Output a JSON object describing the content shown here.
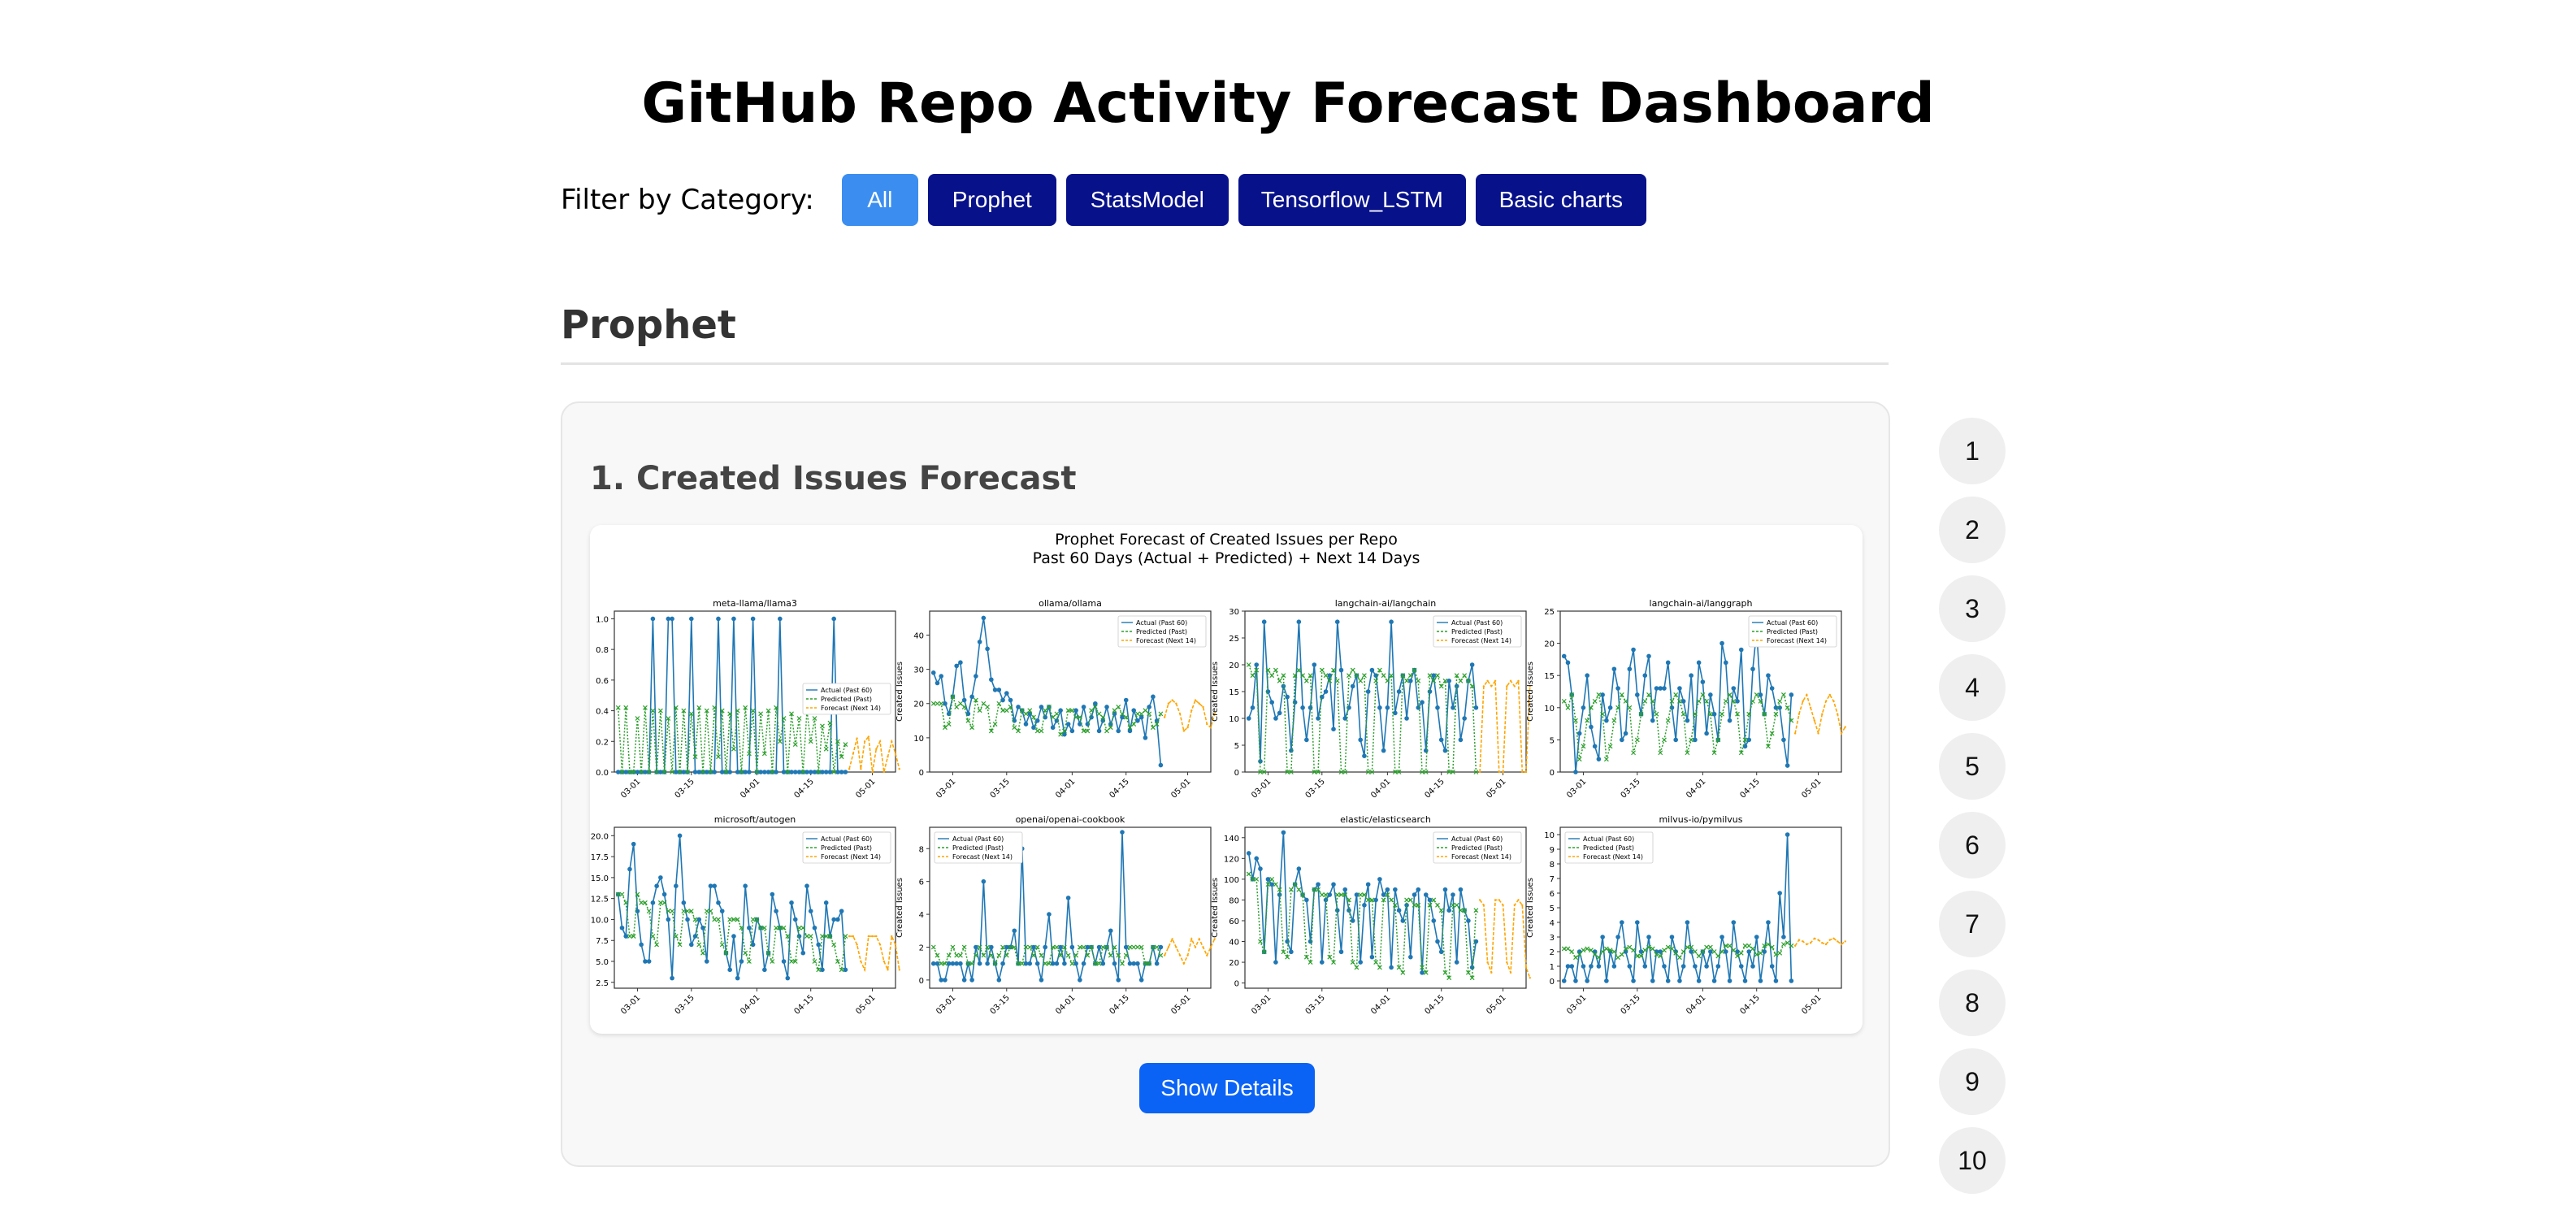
{
  "page": {
    "title": "GitHub Repo Activity Forecast Dashboard"
  },
  "filter": {
    "label": "Filter by Category:",
    "buttons": [
      "All",
      "Prophet",
      "StatsModel",
      "Tensorflow_LSTM",
      "Basic charts"
    ],
    "active": "All"
  },
  "section": {
    "title": "Prophet"
  },
  "card": {
    "title": "1. Created Issues Forecast",
    "button_label": "Show Details"
  },
  "nav": {
    "items": [
      "1",
      "2",
      "3",
      "4",
      "5",
      "6",
      "7",
      "8",
      "9",
      "10"
    ]
  },
  "colors": {
    "actual": "#1f77b4",
    "predicted": "#2ca02c",
    "forecast": "#ffa500",
    "button_dark": "#07118a",
    "button_active": "#3b8ef0",
    "button_primary": "#0b63f6"
  },
  "chart_data": {
    "type": "line",
    "title": "Prophet Forecast of Created Issues per Repo",
    "subtitle": "Past 60 Days (Actual + Predicted) + Next 14 Days",
    "ylabel": "Created Issues",
    "xticks": [
      "03-01",
      "03-15",
      "04-01",
      "04-15",
      "05-01"
    ],
    "x_range": [
      "2024-02-24",
      "2024-05-07"
    ],
    "actual_dates": [
      "2024-02-25",
      "2024-04-24"
    ],
    "forecast_dates": [
      "2024-04-25",
      "2024-05-08"
    ],
    "legend": [
      "Actual (Past 60)",
      "Predicted (Past)",
      "Forecast (Next 14)"
    ],
    "panels": [
      {
        "name": "meta-llama/llama3",
        "ylim": [
          0,
          1.05
        ],
        "yticks": [
          "0.0",
          "0.2",
          "0.4",
          "0.6",
          "0.8",
          "1.0"
        ],
        "legend_pos": "center-right",
        "actual": [
          0,
          0,
          0,
          0,
          0,
          0,
          0,
          0,
          0,
          1,
          0,
          0,
          0,
          1,
          1,
          0,
          0,
          0,
          0,
          1,
          0,
          0,
          0,
          0,
          0,
          0,
          1,
          0,
          0,
          0,
          1,
          0,
          0,
          0,
          0,
          1,
          0,
          0,
          0,
          0,
          0,
          0,
          1,
          0,
          0,
          0,
          0,
          0,
          0,
          0,
          0,
          0,
          0,
          0,
          0,
          0,
          1,
          0,
          0,
          0
        ],
        "predicted": [
          0.42,
          0,
          0.42,
          0,
          0,
          0.35,
          0,
          0.42,
          0,
          0.4,
          0,
          0.4,
          0,
          0.35,
          0,
          0.42,
          0,
          0.4,
          0,
          0.38,
          0.1,
          0.42,
          0,
          0.4,
          0,
          0.42,
          0.1,
          0.4,
          0,
          0.38,
          0.15,
          0.4,
          0,
          0.42,
          0.12,
          0.4,
          0,
          0.38,
          0.12,
          0.4,
          0,
          0.42,
          0.2,
          0.35,
          0,
          0.38,
          0.18,
          0.35,
          0,
          0.4,
          0.2,
          0.35,
          0,
          0.3,
          0.15,
          0.32,
          0,
          0.2,
          0.1,
          0.18
        ],
        "forecast": [
          0.02,
          0.12,
          0.22,
          0.02,
          0.2,
          0.23,
          0,
          0.15,
          0.2,
          0,
          0.1,
          0.2,
          0.12,
          0.02
        ]
      },
      {
        "name": "ollama/ollama",
        "ylim": [
          0,
          47
        ],
        "yticks": [
          "0",
          "10",
          "20",
          "30",
          "40"
        ],
        "legend_pos": "top-right",
        "actual": [
          29,
          26,
          28,
          20,
          17,
          22,
          31,
          32,
          21,
          17,
          22,
          28,
          38,
          45,
          36,
          27,
          24,
          24,
          21,
          23,
          21,
          15,
          19,
          18,
          14,
          17,
          13,
          15,
          19,
          16,
          19,
          13,
          15,
          18,
          11,
          14,
          12,
          18,
          14,
          19,
          14,
          16,
          20,
          12,
          15,
          19,
          14,
          17,
          12,
          16,
          21,
          12,
          18,
          15,
          16,
          10,
          19,
          22,
          15,
          2
        ],
        "predicted": [
          20,
          20,
          20,
          13,
          14,
          22,
          19,
          20,
          19,
          15,
          13,
          21,
          18,
          20,
          19,
          12,
          14,
          20,
          18,
          18,
          19,
          13,
          12,
          18,
          17,
          18,
          16,
          12,
          12,
          18,
          19,
          16,
          17,
          11,
          12,
          18,
          18,
          16,
          16,
          12,
          12,
          18,
          19,
          17,
          16,
          12,
          13,
          18,
          19,
          17,
          16,
          13,
          14,
          17,
          17,
          18,
          17,
          13,
          14,
          17
        ],
        "forecast": [
          16,
          20,
          21,
          20,
          17,
          12,
          13,
          18,
          21,
          20,
          19,
          14,
          13,
          17
        ]
      },
      {
        "name": "langchain-ai/langchain",
        "ylim": [
          0,
          30
        ],
        "yticks": [
          "0",
          "5",
          "10",
          "15",
          "20",
          "25",
          "30"
        ],
        "legend_pos": "top-right",
        "actual": [
          10,
          12,
          20,
          2,
          28,
          15,
          13,
          10,
          11,
          16,
          14,
          4,
          13,
          28,
          12,
          6,
          12,
          20,
          10,
          14,
          15,
          18,
          8,
          28,
          19,
          10,
          12,
          16,
          18,
          6,
          3,
          15,
          19,
          18,
          12,
          4,
          12,
          28,
          11,
          15,
          18,
          10,
          17,
          19,
          12,
          13,
          4,
          15,
          18,
          12,
          6,
          4,
          17,
          12,
          16,
          6,
          10,
          17,
          20,
          12
        ],
        "predicted": [
          20,
          18,
          19,
          0,
          0,
          19,
          18,
          19,
          17,
          18,
          0,
          0,
          18,
          19,
          18,
          17,
          18,
          0,
          0,
          19,
          18,
          17,
          19,
          17,
          0,
          0,
          18,
          19,
          18,
          17,
          18,
          0,
          0,
          17,
          19,
          18,
          17,
          18,
          0,
          0,
          18,
          17,
          18,
          19,
          17,
          0,
          0,
          18,
          17,
          18,
          16,
          17,
          0,
          0,
          18,
          17,
          18,
          17,
          16,
          0
        ],
        "forecast": [
          0,
          16,
          17,
          16,
          17,
          0,
          0,
          16,
          17,
          16,
          17,
          0,
          0,
          16
        ]
      },
      {
        "name": "langchain-ai/langgraph",
        "ylim": [
          0,
          25
        ],
        "yticks": [
          "0",
          "5",
          "10",
          "15",
          "20",
          "25"
        ],
        "legend_pos": "top-right",
        "actual": [
          18,
          17,
          12,
          0,
          6,
          10,
          15,
          7,
          4,
          2,
          12,
          8,
          10,
          16,
          13,
          5,
          6,
          16,
          19,
          12,
          9,
          15,
          18,
          8,
          13,
          13,
          13,
          17,
          10,
          5,
          13,
          11,
          8,
          15,
          5,
          17,
          14,
          6,
          12,
          9,
          5,
          20,
          17,
          8,
          13,
          11,
          19,
          4,
          5,
          16,
          22,
          12,
          9,
          15,
          13,
          10,
          10,
          5,
          1,
          12
        ],
        "predicted": [
          11,
          10,
          12,
          8,
          2,
          4,
          8,
          10,
          11,
          12,
          9,
          2,
          4,
          8,
          10,
          12,
          11,
          10,
          3,
          5,
          9,
          11,
          12,
          11,
          9,
          3,
          5,
          8,
          11,
          12,
          11,
          9,
          3,
          5,
          9,
          11,
          12,
          11,
          9,
          3,
          5,
          9,
          11,
          12,
          11,
          9,
          3,
          5,
          9,
          11,
          12,
          11,
          9,
          4,
          6,
          9,
          11,
          12,
          10,
          8
        ],
        "forecast": [
          6,
          9,
          11,
          12,
          10,
          8,
          6,
          9,
          11,
          12,
          11,
          9,
          6,
          7
        ]
      },
      {
        "name": "microsoft/autogen",
        "ylim": [
          1.8,
          21
        ],
        "yticks": [
          "2.5",
          "5.0",
          "7.5",
          "10.0",
          "12.5",
          "15.0",
          "17.5",
          "20.0"
        ],
        "legend_pos": "top-right",
        "actual": [
          13,
          9,
          8,
          16,
          19,
          11,
          7,
          5,
          5,
          12,
          14,
          15,
          13,
          10,
          3,
          14,
          20,
          12,
          10,
          7,
          8,
          10,
          9,
          5,
          14,
          14,
          12,
          11,
          6,
          4,
          8,
          3,
          5,
          14,
          9,
          7,
          10,
          9,
          4,
          6,
          13,
          11,
          9,
          5,
          3,
          12,
          10,
          8,
          6,
          14,
          11,
          9,
          7,
          4,
          12,
          8,
          10,
          10,
          11,
          4
        ],
        "predicted": [
          13,
          13,
          12,
          8,
          8,
          13,
          12,
          12,
          11,
          8,
          7,
          12,
          12,
          11,
          11,
          8,
          7,
          11,
          11,
          11,
          10,
          7,
          6,
          11,
          11,
          10,
          10,
          7,
          6,
          10,
          10,
          10,
          9,
          6,
          5,
          10,
          10,
          9,
          9,
          6,
          5,
          9,
          9,
          9,
          8,
          5,
          5,
          9,
          9,
          8,
          8,
          5,
          4,
          8,
          8,
          8,
          7,
          5,
          4,
          8
        ],
        "forecast": [
          8,
          8,
          7,
          5,
          4,
          8,
          8,
          8,
          7,
          5,
          4,
          8,
          7,
          4
        ]
      },
      {
        "name": "openai/openai-cookbook",
        "ylim": [
          -0.5,
          9.3
        ],
        "yticks": [
          "0",
          "2",
          "4",
          "6",
          "8"
        ],
        "legend_pos": "top-left",
        "actual": [
          1,
          1,
          0,
          0,
          1,
          1,
          1,
          1,
          0,
          1,
          0,
          2,
          1,
          6,
          1,
          2,
          1,
          0,
          1,
          2,
          2,
          3,
          1,
          8,
          1,
          1,
          2,
          1,
          0,
          2,
          4,
          1,
          1,
          2,
          1,
          5,
          2,
          1,
          0,
          1,
          2,
          2,
          1,
          2,
          1,
          2,
          3,
          1,
          0,
          9,
          2,
          1,
          1,
          1,
          0,
          1,
          1,
          2,
          1,
          2
        ],
        "predicted": [
          2,
          1.5,
          1,
          1,
          1.5,
          2,
          1.5,
          1.5,
          2,
          1,
          1,
          1.5,
          2,
          1.5,
          2,
          1.5,
          1,
          1.5,
          2,
          1.5,
          2,
          2,
          1,
          1,
          2,
          2,
          1.5,
          2,
          1.5,
          1,
          1,
          2,
          2,
          1.5,
          2,
          1.5,
          1,
          1.5,
          2,
          2,
          1.5,
          2,
          1,
          1,
          2,
          2,
          1.5,
          2,
          1.5,
          1,
          1.5,
          2,
          2,
          2,
          2,
          1,
          1,
          2,
          2,
          1.5
        ],
        "forecast": [
          1.5,
          2,
          2.5,
          2,
          1.5,
          1,
          1.5,
          2.5,
          2,
          2.5,
          2,
          1.5,
          2,
          2.5
        ]
      },
      {
        "name": "elastic/elasticsearch",
        "ylim": [
          -5,
          150
        ],
        "yticks": [
          "0",
          "20",
          "40",
          "60",
          "80",
          "100",
          "120",
          "140"
        ],
        "legend_pos": "top-right",
        "actual": [
          125,
          100,
          120,
          110,
          30,
          100,
          95,
          20,
          85,
          145,
          40,
          30,
          95,
          110,
          85,
          80,
          40,
          90,
          95,
          20,
          80,
          85,
          95,
          70,
          30,
          90,
          70,
          60,
          85,
          20,
          75,
          95,
          25,
          80,
          100,
          85,
          90,
          15,
          90,
          70,
          60,
          75,
          25,
          85,
          90,
          10,
          85,
          80,
          60,
          40,
          30,
          90,
          70,
          85,
          20,
          90,
          70,
          60,
          15,
          40
        ],
        "predicted": [
          105,
          100,
          100,
          40,
          30,
          95,
          100,
          95,
          90,
          30,
          25,
          90,
          95,
          90,
          85,
          25,
          20,
          90,
          90,
          85,
          85,
          25,
          20,
          85,
          85,
          85,
          80,
          20,
          15,
          85,
          85,
          80,
          80,
          20,
          15,
          80,
          85,
          80,
          75,
          15,
          10,
          80,
          80,
          75,
          75,
          15,
          10,
          75,
          80,
          75,
          70,
          10,
          5,
          75,
          75,
          70,
          70,
          10,
          5,
          70
        ],
        "forecast": [
          80,
          75,
          20,
          10,
          80,
          80,
          75,
          20,
          10,
          75,
          80,
          75,
          15,
          5
        ]
      },
      {
        "name": "milvus-io/pymilvus",
        "ylim": [
          -0.5,
          10.5
        ],
        "yticks": [
          "0",
          "1",
          "2",
          "3",
          "4",
          "5",
          "6",
          "7",
          "8",
          "9",
          "10"
        ],
        "legend_pos": "top-left",
        "actual": [
          0,
          1,
          1,
          0,
          2,
          1,
          0,
          1,
          2,
          1,
          3,
          0,
          2,
          1,
          3,
          4,
          2,
          1,
          0,
          4,
          2,
          1,
          3,
          0,
          2,
          2,
          1,
          0,
          3,
          2,
          0,
          1,
          4,
          2,
          1,
          0,
          2,
          1,
          2,
          0,
          1,
          3,
          2,
          0,
          4,
          2,
          1,
          0,
          2,
          1,
          3,
          0,
          2,
          4,
          1,
          0,
          6,
          3,
          10,
          0
        ],
        "predicted": [
          2.2,
          2.2,
          2,
          1.6,
          1.8,
          2.1,
          2.2,
          2.1,
          1.8,
          1.6,
          2,
          2.2,
          2.1,
          2,
          1.6,
          1.8,
          2.2,
          2.3,
          2.1,
          1.7,
          1.7,
          2.1,
          2.3,
          2.2,
          1.8,
          1.7,
          2.1,
          2.3,
          2.2,
          1.9,
          1.6,
          2,
          2.3,
          2.3,
          2,
          1.7,
          2,
          2.3,
          2.3,
          2,
          1.7,
          2,
          2.4,
          2.4,
          2.1,
          1.7,
          1.9,
          2.4,
          2.4,
          2.2,
          1.8,
          1.9,
          2.4,
          2.5,
          2.3,
          1.8,
          1.9,
          2.5,
          2.6,
          2.4
        ],
        "forecast": [
          2.4,
          2.8,
          2.7,
          2.5,
          2.6,
          2.9,
          2.8,
          2.6,
          2.5,
          2.8,
          2.9,
          2.7,
          2.5,
          2.7
        ]
      }
    ]
  }
}
